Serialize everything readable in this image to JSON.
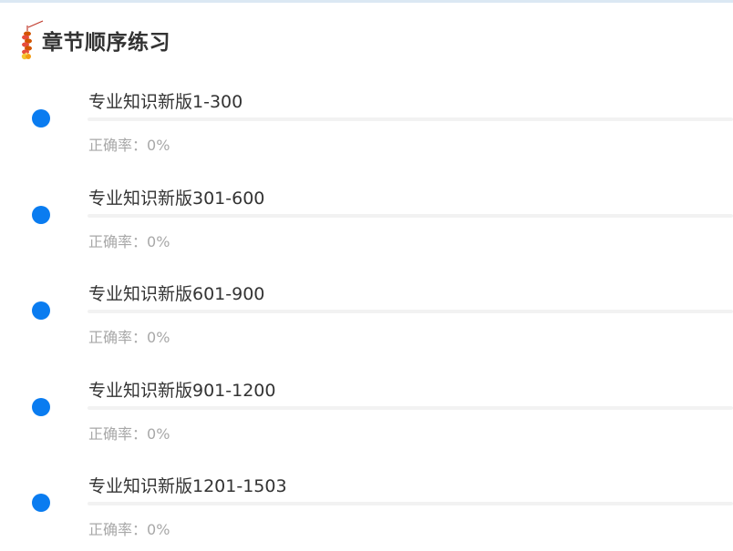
{
  "header": {
    "title": "章节顺序练习",
    "icon": "firecracker-icon"
  },
  "colors": {
    "accent": "#0a7cf0",
    "title_text": "#333333",
    "muted_text": "#a8a8a8",
    "track": "#f2f2f2"
  },
  "chapters": [
    {
      "title": "专业知识新版1-300",
      "accuracy_label": "正确率：",
      "accuracy_value": "0%",
      "progress": 0
    },
    {
      "title": "专业知识新版301-600",
      "accuracy_label": "正确率：",
      "accuracy_value": "0%",
      "progress": 0
    },
    {
      "title": "专业知识新版601-900",
      "accuracy_label": "正确率：",
      "accuracy_value": "0%",
      "progress": 0
    },
    {
      "title": "专业知识新版901-1200",
      "accuracy_label": "正确率：",
      "accuracy_value": "0%",
      "progress": 0
    },
    {
      "title": "专业知识新版1201-1503",
      "accuracy_label": "正确率：",
      "accuracy_value": "0%",
      "progress": 0
    }
  ]
}
